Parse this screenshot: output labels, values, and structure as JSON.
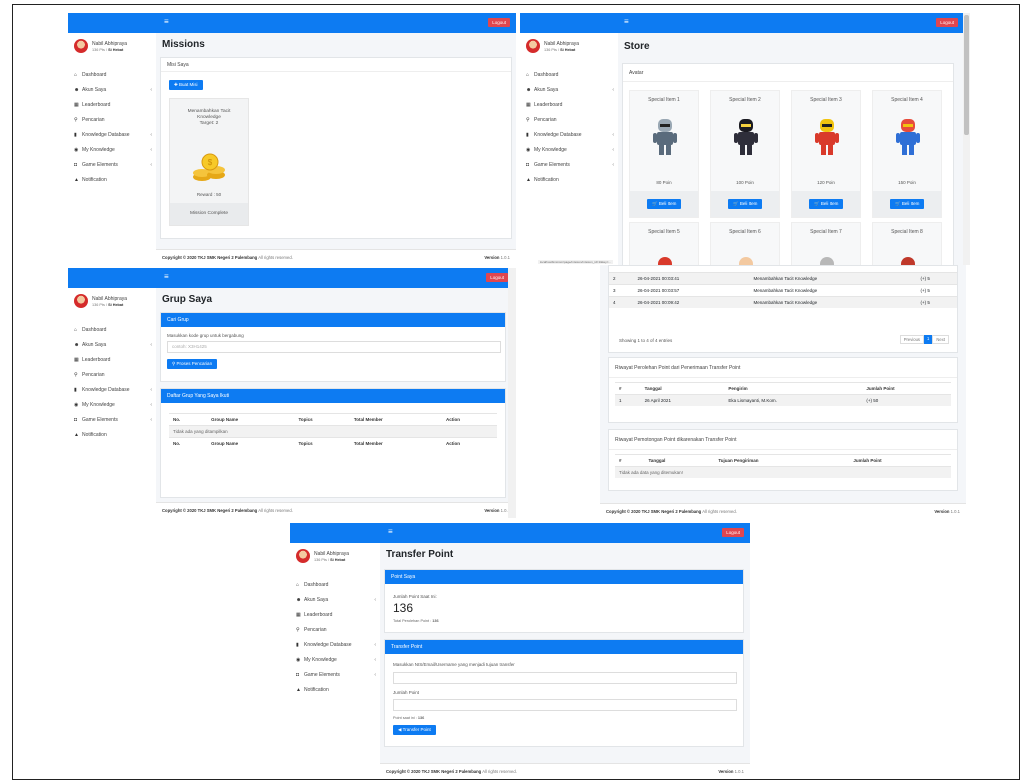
{
  "user": {
    "name": "Nabil Abhipraya",
    "points": "136 Pts",
    "level": "Si Hebat"
  },
  "header": {
    "logout": "Logout",
    "menu_icon": "≡"
  },
  "nav": [
    {
      "label": "Dashboard",
      "icon": "home-icon",
      "glyph": "⌂",
      "chev": ""
    },
    {
      "label": "Akun Saya",
      "icon": "users-icon",
      "glyph": "☻",
      "chev": "‹"
    },
    {
      "label": "Leaderboard",
      "icon": "table-icon",
      "glyph": "▦",
      "chev": ""
    },
    {
      "label": "Pencarian",
      "icon": "search-icon",
      "glyph": "⚲",
      "chev": ""
    },
    {
      "label": "Knowledge Database",
      "icon": "book-icon",
      "glyph": "▮",
      "chev": "‹"
    },
    {
      "label": "My Knowledge",
      "icon": "globe-icon",
      "glyph": "◉",
      "chev": "‹"
    },
    {
      "label": "Game Elements",
      "icon": "gamepad-icon",
      "glyph": "◘",
      "chev": "‹"
    },
    {
      "label": "Notification",
      "icon": "bell-icon",
      "glyph": "▲",
      "chev": ""
    }
  ],
  "footer": {
    "copyright": "Copyright © 2020 TKJ SMK Negeri 2 Palembang",
    "rights": "All rights reserved.",
    "version_label": "Version",
    "version": "1.0.1"
  },
  "missions": {
    "title": "Missions",
    "card_title": "Misi Saya",
    "button": "Buat Misi",
    "mission_name": "Menambahkan Tacit Knowledge",
    "mission_target": "Target: 2",
    "reward": "Reward : 50",
    "status": "Mission Complete"
  },
  "store": {
    "title": "Store",
    "section": "Avatar",
    "buy_label": "Beli Item",
    "items": [
      {
        "name": "Special Item 1",
        "price": "80 Poin"
      },
      {
        "name": "Special Item 2",
        "price": "100 Poin"
      },
      {
        "name": "Special Item 3",
        "price": "120 Poin"
      },
      {
        "name": "Special Item 4",
        "price": "150 Poin"
      }
    ],
    "items_row2": [
      "Special Item 5",
      "Special Item 6",
      "Special Item 7",
      "Special Item 8"
    ],
    "status_url": "localhost/kmmsm/page/mission/mission_id=1&key=..."
  },
  "grup": {
    "title": "Grup Saya",
    "search_head": "Cari Grup",
    "search_label": "Masukkan kode grup untuk bergabung",
    "search_placeholder": "contoh: X3H1425",
    "search_button": "Proses Pencarian",
    "list_head": "Daftar Grup Yang Saya Ikuti",
    "columns": [
      "No.",
      "Group Name",
      "Topics",
      "Total Member",
      "Action"
    ],
    "empty": "Tidak ada yang ditampilkan"
  },
  "history": {
    "rows": [
      {
        "no": "2",
        "date": "26-04-2021 00:03:41",
        "desc": "Menambahkan Tacit Knowledge",
        "pts": "(+) 5"
      },
      {
        "no": "3",
        "date": "26-04-2021 00:03:57",
        "desc": "Menambahkan Tacit Knowledge",
        "pts": "(+) 5"
      },
      {
        "no": "4",
        "date": "26-04-2021 00:09:42",
        "desc": "Menambahkan Tacit Knowledge",
        "pts": "(+) 5"
      }
    ],
    "showing": "Showing 1 to 4 of 4 entries",
    "prev": "Previous",
    "page": "1",
    "next": "Next",
    "receive_head": "Riwayat Perolehan Point dari Penerimaan Transfer Point",
    "receive_cols": [
      "#",
      "Tanggal",
      "Pengirim",
      "Jumlah Point"
    ],
    "receive_row": {
      "no": "1",
      "date": "26 April 2021",
      "sender": "Eka Lismayanti, M.Kom.",
      "pts": "(+) 50"
    },
    "cut_head": "Riwayat Pemotongan Point dikarenakan Transfer Point",
    "cut_cols": [
      "#",
      "Tanggal",
      "Tujuan Pengiriman",
      "Jumlah Point"
    ],
    "cut_empty": "Tidak ada data yang ditemukan!"
  },
  "transfer": {
    "title": "Transfer Point",
    "point_head": "Point Saya",
    "current_label": "Jumlah Point Saat Ini:",
    "current_value": "136",
    "total_label": "Total Perolehan Point :",
    "total_value": "136",
    "transfer_head": "Transfer Point",
    "target_label": "Masukkan NIS/Email/Username yang menjadi tujuan transfer",
    "amount_label": "Jumlah Point",
    "point_now_label": "Point saat ini :",
    "point_now_value": "136",
    "button": "Transfer Point"
  }
}
